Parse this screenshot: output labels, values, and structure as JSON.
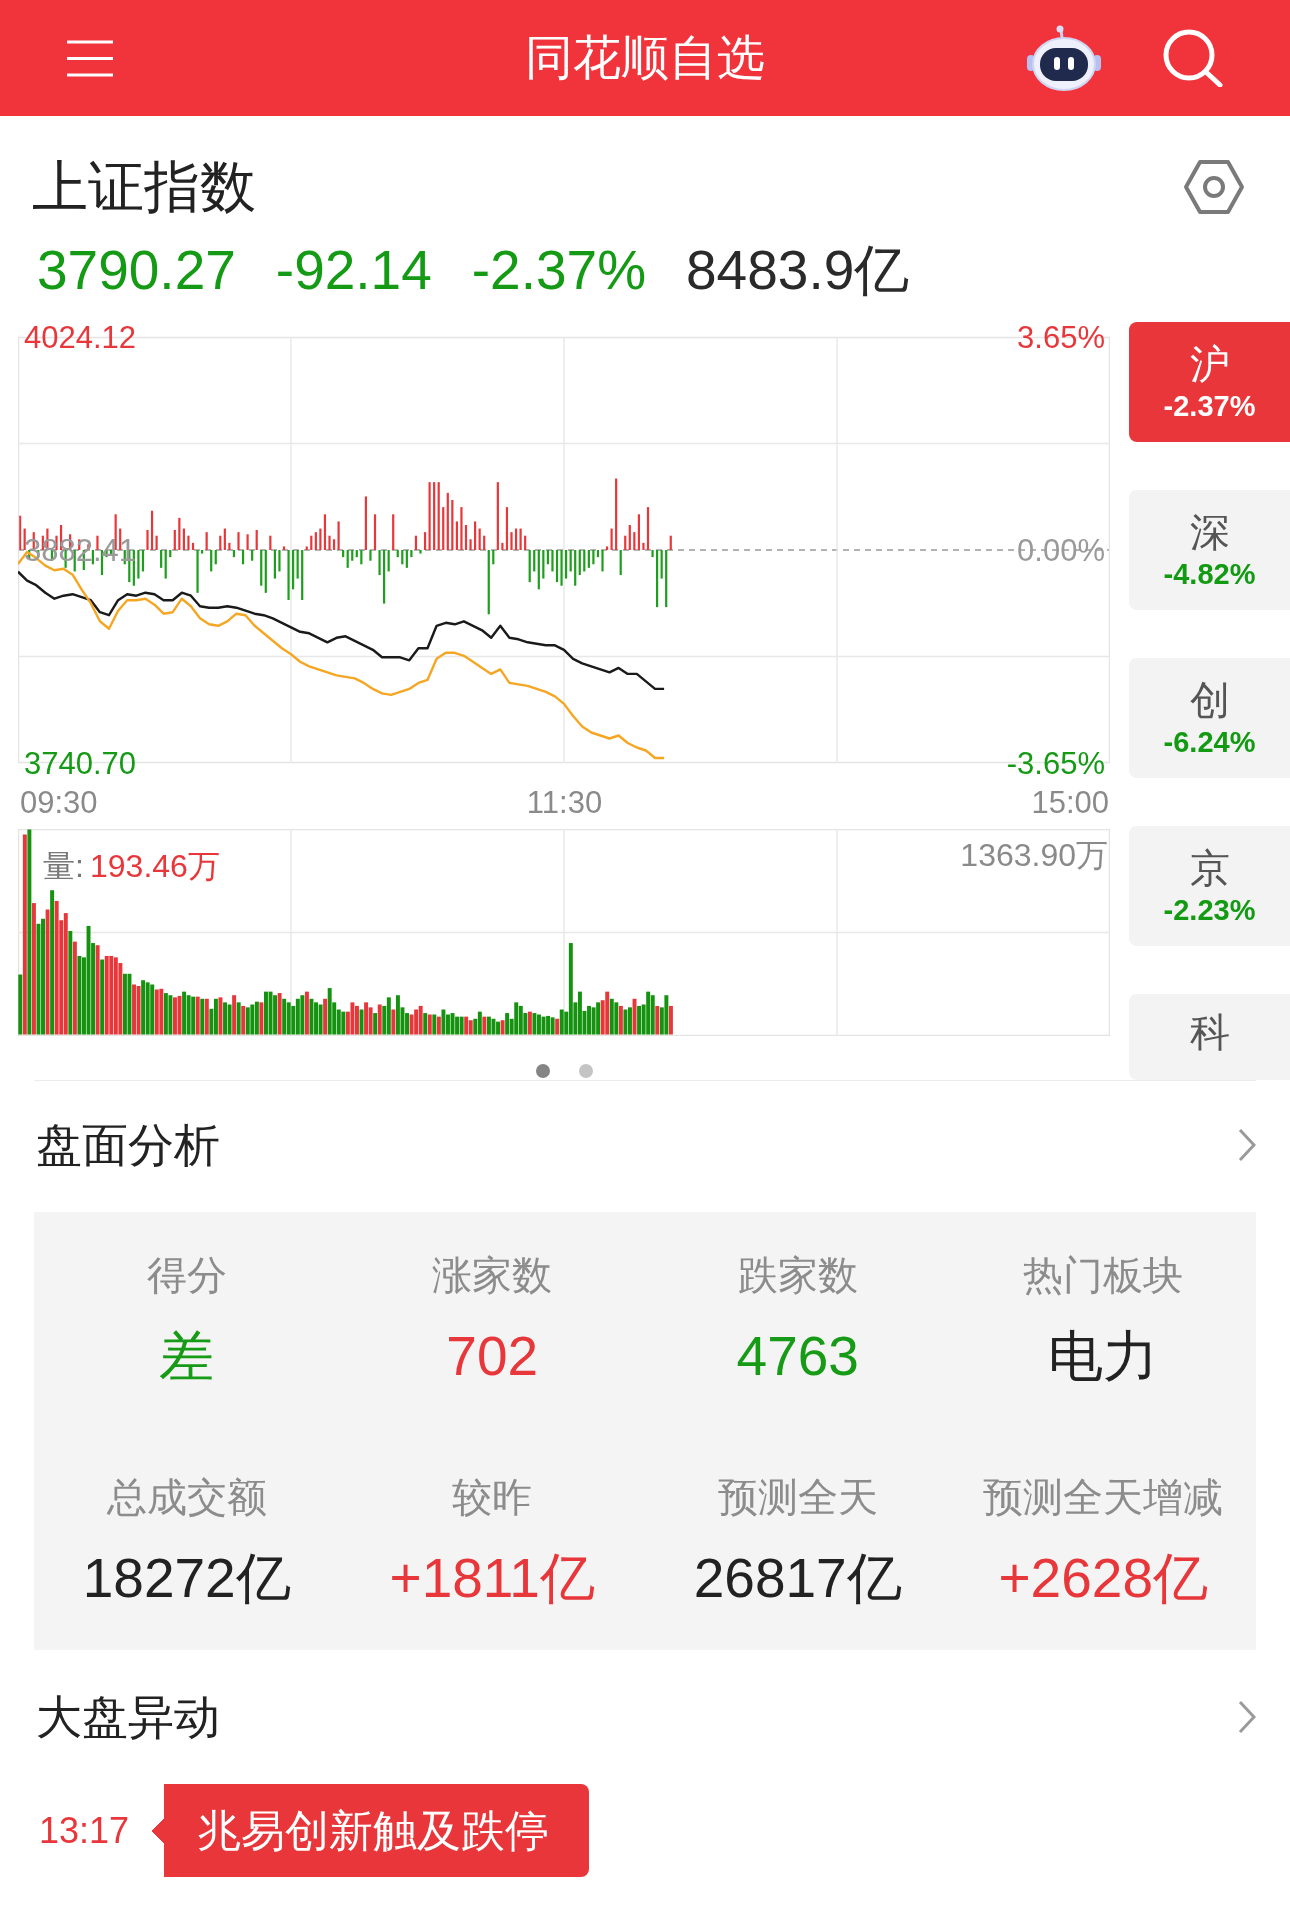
{
  "header": {
    "title": "同花顺自选"
  },
  "index": {
    "name": "上证指数",
    "quote": [
      {
        "text": "3790.27",
        "color": "#149a14"
      },
      {
        "text": "-92.14",
        "color": "#149a14"
      },
      {
        "text": "-2.37%",
        "color": "#149a14"
      },
      {
        "text": "8483.9亿",
        "color": "#2a2a2a"
      }
    ]
  },
  "intraday_chart": {
    "chart_data": {
      "type": "line",
      "grid": true,
      "categories": [
        null,
        null,
        null,
        null,
        null,
        null,
        null,
        null,
        null,
        null,
        null,
        null,
        null,
        null,
        null,
        null,
        null,
        null,
        null,
        null,
        null,
        null,
        null,
        null,
        null,
        null,
        null,
        null,
        null,
        null,
        null,
        null,
        null,
        null,
        null,
        null,
        null,
        null,
        null,
        null,
        null,
        null,
        null,
        null,
        null,
        null,
        null,
        null,
        null,
        null,
        null,
        null,
        null,
        null,
        null,
        null,
        null,
        null,
        null,
        null,
        null,
        null,
        null,
        null,
        null,
        null,
        null,
        null,
        null,
        null,
        null,
        null,
        null,
        null,
        null,
        null,
        null,
        null,
        null,
        null,
        null,
        null,
        null,
        null,
        null,
        null,
        null,
        null,
        null,
        null,
        null,
        null,
        null,
        null,
        null,
        null,
        null,
        null,
        null,
        null,
        null,
        null,
        null,
        null,
        null,
        null,
        null,
        null,
        null,
        null,
        null,
        null,
        null,
        null,
        null,
        null,
        null,
        null,
        null,
        null,
        null
      ],
      "ylim": [
        3740.7,
        4024.12
      ],
      "yticks": [
        {
          "value": 4024.12,
          "label": "4024.12"
        },
        {
          "value": 3882.41,
          "label": "3882.41"
        },
        {
          "value": 3740.7,
          "label": "3740.70"
        }
      ],
      "series": [
        {
          "color": "#1a1a1a",
          "values": [
            3868,
            3862,
            3859,
            3854,
            3850,
            3852,
            3853,
            3851,
            3849,
            3841,
            3839,
            3849,
            3853,
            3852,
            3854,
            3853,
            3849,
            3849,
            3854,
            3852,
            3845,
            3844,
            3844,
            3845,
            3844,
            3842,
            3840,
            3839,
            3837,
            3834,
            3831,
            3828,
            3827,
            3824,
            3821,
            3824,
            3825,
            3822,
            3819,
            3816,
            3811,
            3811,
            3811,
            3809,
            3817,
            3817,
            3832,
            3834,
            3833,
            3835,
            3832,
            3829,
            3824,
            3832,
            3824,
            3823,
            3821,
            3820,
            3819,
            3819,
            3816,
            3810,
            3807,
            3805,
            3803,
            3801,
            3804,
            3800,
            3800,
            3795,
            3790,
            3790,
            null,
            null,
            null,
            null,
            null,
            null,
            null,
            null,
            null,
            null,
            null,
            null,
            null,
            null,
            null,
            null,
            null,
            null,
            null,
            null,
            null,
            null,
            null,
            null,
            null,
            null,
            null,
            null,
            null,
            null,
            null,
            null,
            null,
            null,
            null,
            null,
            null,
            null,
            null,
            null,
            null,
            null,
            null,
            null,
            null,
            null,
            null,
            null,
            null
          ]
        },
        {
          "color": "#f5a623",
          "values": [
            3873,
            3881,
            3877,
            3872,
            3869,
            3870,
            3866,
            3856,
            3847,
            3835,
            3830,
            3842,
            3849,
            3849,
            3850,
            3846,
            3840,
            3841,
            3850,
            3845,
            3837,
            3833,
            3832,
            3835,
            3840,
            3839,
            3832,
            3827,
            3822,
            3817,
            3813,
            3808,
            3805,
            3803,
            3801,
            3799,
            3798,
            3797,
            3794,
            3790,
            3787,
            3786,
            3788,
            3790,
            3794,
            3796,
            3810,
            3814,
            3814,
            3812,
            3808,
            3804,
            3800,
            3803,
            3794,
            3793,
            3792,
            3790,
            3788,
            3785,
            3780,
            3772,
            3765,
            3761,
            3759,
            3757,
            3759,
            3754,
            3751,
            3749,
            3744,
            3744,
            null,
            null,
            null,
            null,
            null,
            null,
            null,
            null,
            null,
            null,
            null,
            null,
            null,
            null,
            null,
            null,
            null,
            null,
            null,
            null,
            null,
            null,
            null,
            null,
            null,
            null,
            null,
            null,
            null,
            null,
            null,
            null,
            null,
            null,
            null,
            null,
            null,
            null,
            null,
            null,
            null,
            null,
            null,
            null,
            null,
            null,
            null,
            null,
            null
          ]
        }
      ]
    },
    "percent_labels": [
      {
        "text": "3.65%",
        "color": "#e8373a"
      },
      {
        "text": "0.00%",
        "color": "#9a9a9a"
      },
      {
        "text": "-3.65%",
        "color": "#149a14"
      }
    ],
    "time_labels": [
      "09:30",
      "11:30",
      "15:00"
    ]
  },
  "volume": {
    "label": "量:",
    "current": "193.46万",
    "max": "1363.90万"
  },
  "pager": [
    {
      "selected": true
    },
    {
      "selected": false
    }
  ],
  "market_tabs": [
    {
      "label": "沪",
      "change": "-2.37%",
      "selected": true
    },
    {
      "label": "深",
      "change": "-4.82%",
      "selected": false
    },
    {
      "label": "创",
      "change": "-6.24%",
      "selected": false
    },
    {
      "label": "京",
      "change": "-2.23%",
      "selected": false
    },
    {
      "label": "科",
      "selected": false
    }
  ],
  "market_analysis": {
    "title": "盘面分析",
    "stats": [
      {
        "label": "得分",
        "value": "差",
        "color": "#179b17"
      },
      {
        "label": "涨家数",
        "value": "702",
        "color": "#e8373a"
      },
      {
        "label": "跌家数",
        "value": "4763",
        "color": "#179b17"
      },
      {
        "label": "热门板块",
        "value": "电力",
        "color": "#222222"
      },
      {
        "label": "总成交额",
        "value": "18272亿",
        "color": "#222222"
      },
      {
        "label": "较昨",
        "value": "+1811亿",
        "color": "#e8373a"
      },
      {
        "label": "预测全天",
        "value": "26817亿",
        "color": "#222222"
      },
      {
        "label": "预测全天增减",
        "value": "+2628亿",
        "color": "#e8373a"
      }
    ]
  },
  "market_moves": {
    "title": "大盘异动",
    "events": [
      {
        "time": "13:17",
        "text": "兆易创新触及跌停"
      }
    ]
  }
}
